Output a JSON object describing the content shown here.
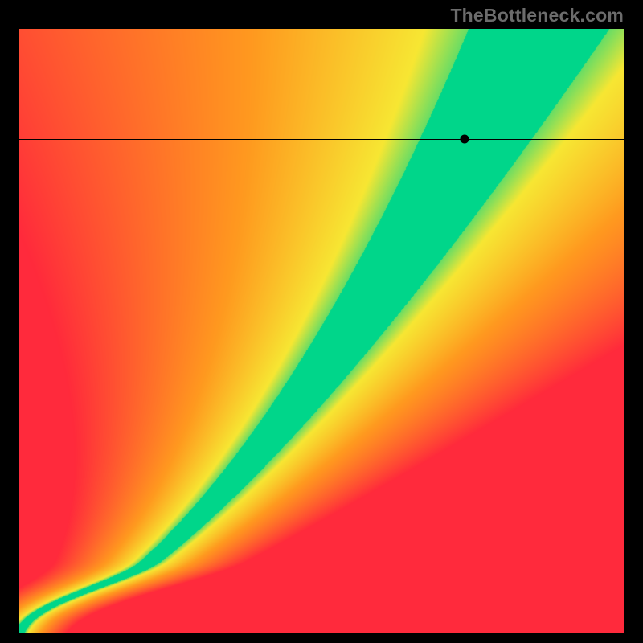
{
  "watermark": "TheBottleneck.com",
  "chart_data": {
    "type": "heatmap",
    "title": "",
    "xlabel": "",
    "ylabel": "",
    "xlim": [
      0,
      100
    ],
    "ylim": [
      0,
      100
    ],
    "crosshair": {
      "x": 73.7,
      "y": 81.8
    },
    "marker": {
      "x": 73.7,
      "y": 81.8
    },
    "ridge": {
      "description": "Green optimal band runs along an S-shaped curve from (0,0) to (~86,100); exponent >1 makes it steeper than diagonal in upper half.",
      "exponent": 1.55,
      "top_x_at_y100": 86,
      "band_half_width_at_mid": 4.0
    },
    "colors": {
      "optimal": "#00d68a",
      "warn": "#f7e733",
      "mid": "#ff9a1f",
      "bad": "#ff2a3c"
    }
  }
}
